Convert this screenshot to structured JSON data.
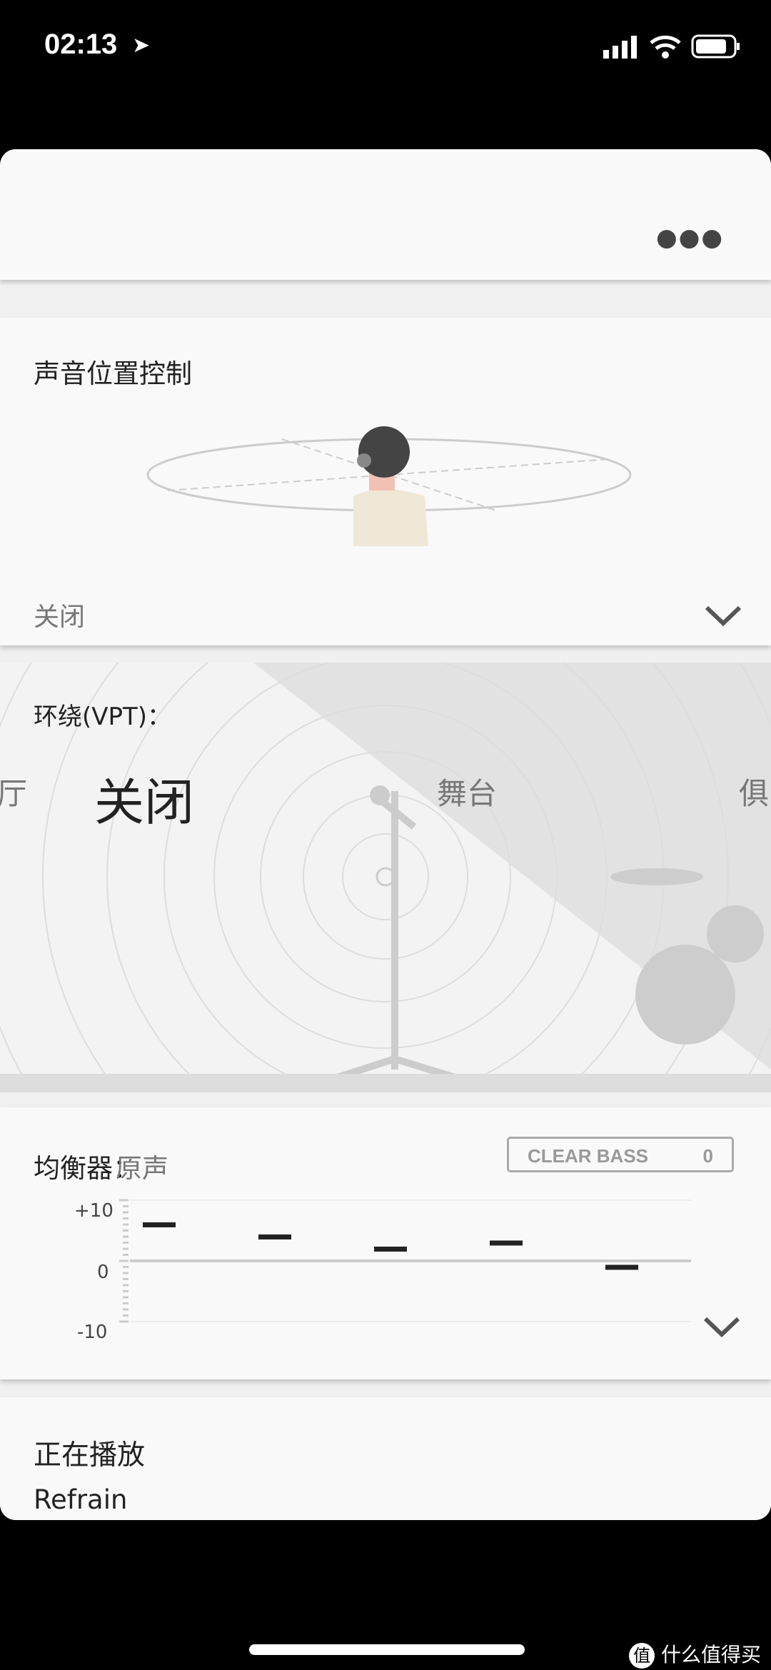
{
  "status_bar": {
    "time": "02:13"
  },
  "header": {
    "more_icon": "ellipsis-icon"
  },
  "sound_position": {
    "title": "声音位置控制",
    "value": "关闭"
  },
  "surround": {
    "label": "环绕(VPT)：",
    "options": [
      "厅",
      "关闭",
      "舞台",
      "俱"
    ],
    "selected": "关闭"
  },
  "equalizer": {
    "label": "均衡器：",
    "preset": "原声",
    "clear_bass_label": "CLEAR BASS",
    "clear_bass_value": "0",
    "chart_data": {
      "type": "bar",
      "ylim": [
        -10,
        10
      ],
      "tick_labels": [
        "+10",
        "0",
        "-10"
      ],
      "values": [
        6,
        4,
        2,
        3,
        -1
      ]
    }
  },
  "now_playing": {
    "title": "正在播放",
    "track": "Refrain"
  },
  "watermark": {
    "text": "什么值得买",
    "badge": "值"
  }
}
